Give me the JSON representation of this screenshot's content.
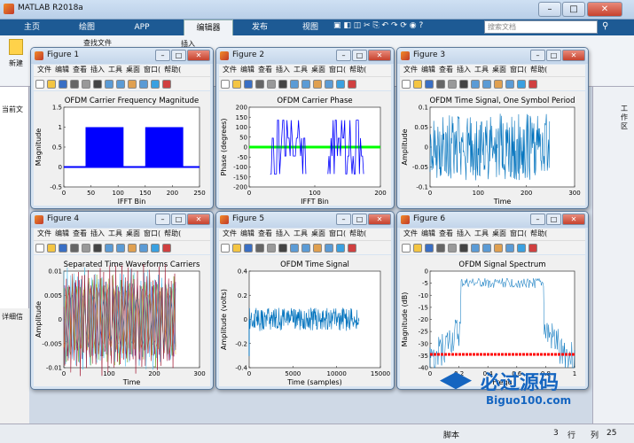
{
  "app": {
    "title": "MATLAB R2018a"
  },
  "ribbon": {
    "tabs": [
      "主页",
      "绘图",
      "APP",
      "编辑器",
      "发布",
      "视图"
    ],
    "active": "编辑器",
    "search_placeholder": "搜索文档",
    "new_label": "新建",
    "find_file_label": "查找文件",
    "insert_label": "插入"
  },
  "left": {
    "current_folder": "当前文",
    "details": "详细信"
  },
  "right": {
    "workspace": "工作区"
  },
  "status": {
    "script": "脚本",
    "row_label": "行",
    "row": "3",
    "col_label": "列",
    "col": "25"
  },
  "menu": [
    "文件",
    "编辑",
    "查看",
    "插入",
    "工具",
    "桌面",
    "窗口(",
    "帮助("
  ],
  "figures": [
    {
      "title": "Figure 1",
      "plot_title": "OFDM Carrier Frequency Magnitude",
      "xlabel": "IFFT Bin",
      "ylabel": "Magnitude",
      "xticks": [
        "0",
        "50",
        "100",
        "150",
        "200",
        "250"
      ],
      "yticks": [
        "1.5",
        "1",
        "0.5",
        "0",
        "-0.5"
      ]
    },
    {
      "title": "Figure 2",
      "plot_title": "OFDM Carrier Phase",
      "xlabel": "IFFT Bin",
      "ylabel": "Phase (degrees)",
      "xticks": [
        "0",
        "100",
        "200"
      ],
      "yticks": [
        "200",
        "150",
        "100",
        "50",
        "0",
        "-50",
        "-100",
        "-150",
        "-200"
      ]
    },
    {
      "title": "Figure 3",
      "plot_title": "OFDM Time Signal, One Symbol Period",
      "xlabel": "Time",
      "ylabel": "Amplitude",
      "xticks": [
        "0",
        "100",
        "200",
        "300"
      ],
      "yticks": [
        "0.1",
        "0.05",
        "0",
        "-0.05",
        "-0.1"
      ]
    },
    {
      "title": "Figure 4",
      "plot_title": "Separated Time Waveforms Carriers",
      "xlabel": "Time",
      "ylabel": "Amplitude",
      "xticks": [
        "0",
        "100",
        "200",
        "300"
      ],
      "yticks": [
        "0.01",
        "0.005",
        "0",
        "-0.005",
        "-0.01"
      ]
    },
    {
      "title": "Figure 5",
      "plot_title": "OFDM Time Signal",
      "xlabel": "Time (samples)",
      "ylabel": "Amplitude (volts)",
      "xticks": [
        "0",
        "5000",
        "10000",
        "15000"
      ],
      "yticks": [
        "0.4",
        "0.2",
        "0",
        "-0.2",
        "-0.4"
      ]
    },
    {
      "title": "Figure 6",
      "plot_title": "OFDM Signal Spectrum",
      "xlabel": "Frequ",
      "ylabel": "Magnitude (dB)",
      "xticks": [
        "0",
        "0.2",
        "0.4",
        "0.6",
        "0.8",
        "1"
      ],
      "yticks": [
        "0",
        "-5",
        "-10",
        "-15",
        "-20",
        "-25",
        "-30",
        "-35",
        "-40"
      ]
    }
  ],
  "watermark": {
    "text": "必过源码",
    "url": "Biguo100.com"
  },
  "colors": {
    "accent": "#1d5a94",
    "plot_blue": "#0000ff",
    "plot_line": "#0072bd",
    "green": "#00ff00",
    "red": "#ff0000"
  }
}
